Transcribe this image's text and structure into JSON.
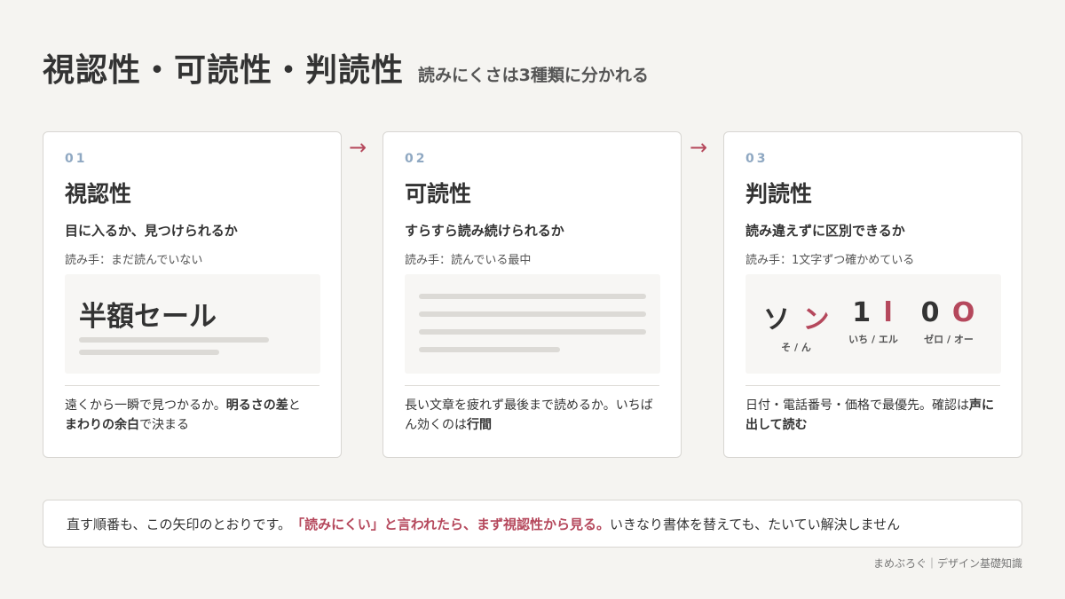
{
  "header": {
    "title": "視認性・可読性・判読性",
    "subtitle": "読みにくさは3種類に分かれる"
  },
  "arrows": [
    "→",
    "→"
  ],
  "cards": [
    {
      "num": "01",
      "title": "視認性",
      "tagline": "目に入るか、見つけられるか",
      "reader": "読み手：まだ読んでいない",
      "demo_text": "半額セール",
      "desc_parts": [
        "遠くから一瞬で見つかるか。",
        "明るさの差",
        "と",
        "まわりの余白",
        "で決まる"
      ]
    },
    {
      "num": "02",
      "title": "可読性",
      "tagline": "すらすら読み続けられるか",
      "reader": "読み手：読んでいる最中",
      "desc_parts": [
        "長い文章を疲れず最後まで読めるか。いちばん効くのは",
        "行間"
      ]
    },
    {
      "num": "03",
      "title": "判読性",
      "tagline": "読み違えずに区別できるか",
      "reader": "読み手：1文字ずつ確かめている",
      "pairs": [
        {
          "a": "ソ",
          "b": "ン",
          "label": "そ / ん"
        },
        {
          "a": "1",
          "b": "l",
          "label": "いち / エル"
        },
        {
          "a": "0",
          "b": "O",
          "label": "ゼロ / オー"
        }
      ],
      "desc_parts": [
        "日付・電話番号・価格で最優先。確認は",
        "声に出して読む"
      ]
    }
  ],
  "note": {
    "pre": "直す順番も、この矢印のとおりです。",
    "emph": "「読みにくい」と言われたら、まず視認性から見る。",
    "post": "いきなり書体を替えても、たいてい解決しません"
  },
  "footer": "まめぶろぐ｜デザイン基礎知識",
  "colors": {
    "accent": "#b5485c",
    "num": "#8fa8c2",
    "background": "#f5f4f1"
  }
}
